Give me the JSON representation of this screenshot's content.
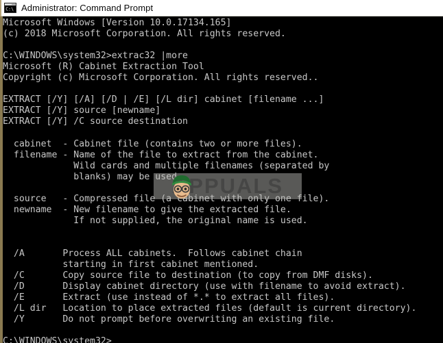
{
  "window": {
    "title": "Administrator: Command Prompt",
    "icon": "console-window-icon",
    "titlebar_bg": "#ffffff",
    "console_bg": "#000000",
    "console_fg": "#c8c8c8",
    "console_border": "#8a7a50"
  },
  "console": {
    "lines": [
      "Microsoft Windows [Version 10.0.17134.165]",
      "(c) 2018 Microsoft Corporation. All rights reserved.",
      "",
      "C:\\WINDOWS\\system32>extrac32 |more",
      "Microsoft (R) Cabinet Extraction Tool",
      "Copyright (c) Microsoft Corporation. All rights reserved..",
      "",
      "EXTRACT [/Y] [/A] [/D | /E] [/L dir] cabinet [filename ...]",
      "EXTRACT [/Y] source [newname]",
      "EXTRACT [/Y] /C source destination",
      "",
      "  cabinet  - Cabinet file (contains two or more files).",
      "  filename - Name of the file to extract from the cabinet.",
      "             Wild cards and multiple filenames (separated by",
      "             blanks) may be used.",
      "",
      "  source   - Compressed file (a cabinet with only one file).",
      "  newname  - New filename to give the extracted file.",
      "             If not supplied, the original name is used.",
      "",
      "",
      "  /A       Process ALL cabinets.  Follows cabinet chain",
      "           starting in first cabinet mentioned.",
      "  /C       Copy source file to destination (to copy from DMF disks).",
      "  /D       Display cabinet directory (use with filename to avoid extract).",
      "  /E       Extract (use instead of *.* to extract all files).",
      "  /L dir   Location to place extracted files (default is current directory).",
      "  /Y       Do not prompt before overwriting an existing file.",
      "",
      "C:\\WINDOWS\\system32>"
    ]
  },
  "watermark": {
    "text": "APPUALS",
    "mascot": "appuals-mascot-icon"
  }
}
